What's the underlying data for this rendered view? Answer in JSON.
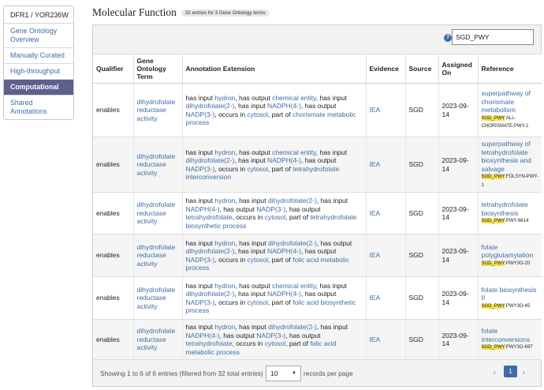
{
  "sidebar": {
    "header": "DFR1 / YOR236W",
    "items": [
      {
        "label": "Gene Ontology Overview",
        "active": false
      },
      {
        "label": "Manually Curated",
        "active": false
      },
      {
        "label": "High-throughput",
        "active": false
      },
      {
        "label": "Computational",
        "active": true
      },
      {
        "label": "Shared Annotations",
        "active": false
      }
    ]
  },
  "section": {
    "title": "Molecular Function",
    "badge": "32 entries for 3 Gene Ontology terms"
  },
  "search": {
    "help_icon": "question-circle-icon",
    "value": "SGD_PWY"
  },
  "table": {
    "headers": [
      "Qualifier",
      "Gene Ontology Term",
      "Annotation Extension",
      "Evidence",
      "Source",
      "Assigned On",
      "Reference"
    ],
    "rows": [
      {
        "qualifier": "enables",
        "term": "dihydrofolate reductase activity",
        "extension": [
          [
            "t",
            "has input "
          ],
          [
            "l",
            "hydron"
          ],
          [
            "t",
            ", has output "
          ],
          [
            "l",
            "chemical entity"
          ],
          [
            "t",
            ", has input "
          ],
          [
            "l",
            "dihydrofolate(2-)"
          ],
          [
            "t",
            ", has input "
          ],
          [
            "l",
            "NADPH(4-)"
          ],
          [
            "t",
            ", has output "
          ],
          [
            "l",
            "NADP(3-)"
          ],
          [
            "t",
            ", occurs in "
          ],
          [
            "l",
            "cytosol"
          ],
          [
            "t",
            ", part of "
          ],
          [
            "l",
            "chorismate metabolic process"
          ]
        ],
        "evidence": "IEA",
        "source": "SGD",
        "assigned": "2023-09-14",
        "ref_title": "superpathway of chorismate metabolism",
        "ref_prefix": "SGD_PWY",
        "ref_suffix": ":ALL-CHORISMATE-PWY-1"
      },
      {
        "qualifier": "enables",
        "term": "dihydrofolate reductase activity",
        "extension": [
          [
            "t",
            "has input "
          ],
          [
            "l",
            "hydron"
          ],
          [
            "t",
            ", has output "
          ],
          [
            "l",
            "chemical entity"
          ],
          [
            "t",
            ", has input "
          ],
          [
            "l",
            "dihydrofolate(2-)"
          ],
          [
            "t",
            ", has input "
          ],
          [
            "l",
            "NADPH(4-)"
          ],
          [
            "t",
            ", has output "
          ],
          [
            "l",
            "NADP(3-)"
          ],
          [
            "t",
            ", occurs in "
          ],
          [
            "l",
            "cytosol"
          ],
          [
            "t",
            ", part of "
          ],
          [
            "l",
            "tetrahydrofolate interconversion"
          ]
        ],
        "evidence": "IEA",
        "source": "SGD",
        "assigned": "2023-09-14",
        "ref_title": "superpathway of tetrahydrofolate biosynthesis and salvage",
        "ref_prefix": "SGD_PWY",
        "ref_suffix": ":FOLSYN-PWY-1"
      },
      {
        "qualifier": "enables",
        "term": "dihydrofolate reductase activity",
        "extension": [
          [
            "t",
            "has input "
          ],
          [
            "l",
            "hydron"
          ],
          [
            "t",
            ", has input "
          ],
          [
            "l",
            "dihydrofolate(2-)"
          ],
          [
            "t",
            ", has input "
          ],
          [
            "l",
            "NADPH(4-)"
          ],
          [
            "t",
            ", has output "
          ],
          [
            "l",
            "NADP(3-)"
          ],
          [
            "t",
            ", has output "
          ],
          [
            "l",
            "tetrahydrofolate"
          ],
          [
            "t",
            ", occurs in "
          ],
          [
            "l",
            "cytosol"
          ],
          [
            "t",
            ", part of "
          ],
          [
            "l",
            "tetrahydrofolate biosynthetic process"
          ]
        ],
        "evidence": "IEA",
        "source": "SGD",
        "assigned": "2023-09-14",
        "ref_title": "tetrahydrofolate biosynthesis",
        "ref_prefix": "SGD_PWY",
        "ref_suffix": ":PWY-6614"
      },
      {
        "qualifier": "enables",
        "term": "dihydrofolate reductase activity",
        "extension": [
          [
            "t",
            "has input "
          ],
          [
            "l",
            "hydron"
          ],
          [
            "t",
            ", has input "
          ],
          [
            "l",
            "dihydrofolate(2-)"
          ],
          [
            "t",
            ", has output "
          ],
          [
            "l",
            "dihydrofolate(2-)"
          ],
          [
            "t",
            ", has input "
          ],
          [
            "l",
            "NADPH(4-)"
          ],
          [
            "t",
            ", has output "
          ],
          [
            "l",
            "NADP(3-)"
          ],
          [
            "t",
            ", occurs in "
          ],
          [
            "l",
            "cytosol"
          ],
          [
            "t",
            ", part of "
          ],
          [
            "l",
            "folic acid metabolic process"
          ]
        ],
        "evidence": "IEA",
        "source": "SGD",
        "assigned": "2023-09-14",
        "ref_title": "folate polyglutamylation",
        "ref_prefix": "SGD_PWY",
        "ref_suffix": ":PWY3O-20"
      },
      {
        "qualifier": "enables",
        "term": "dihydrofolate reductase activity",
        "extension": [
          [
            "t",
            "has input "
          ],
          [
            "l",
            "hydron"
          ],
          [
            "t",
            ", has output "
          ],
          [
            "l",
            "chemical entity"
          ],
          [
            "t",
            ", has input "
          ],
          [
            "l",
            "dihydrofolate(2-)"
          ],
          [
            "t",
            ", has input "
          ],
          [
            "l",
            "NADPH(4-)"
          ],
          [
            "t",
            ", has output "
          ],
          [
            "l",
            "NADP(3-)"
          ],
          [
            "t",
            ", occurs in "
          ],
          [
            "l",
            "cytosol"
          ],
          [
            "t",
            ", part of "
          ],
          [
            "l",
            "folic acid biosynthetic process"
          ]
        ],
        "evidence": "IEA",
        "source": "SGD",
        "assigned": "2023-09-14",
        "ref_title": "folate biosynthesis II",
        "ref_prefix": "SGD_PWY",
        "ref_suffix": ":PWY3O-45"
      },
      {
        "qualifier": "enables",
        "term": "dihydrofolate reductase activity",
        "extension": [
          [
            "t",
            "has input "
          ],
          [
            "l",
            "hydron"
          ],
          [
            "t",
            ", has input "
          ],
          [
            "l",
            "dihydrofolate(2-)"
          ],
          [
            "t",
            ", has input "
          ],
          [
            "l",
            "NADPH(4-)"
          ],
          [
            "t",
            ", has output "
          ],
          [
            "l",
            "NADP(3-)"
          ],
          [
            "t",
            ", has output "
          ],
          [
            "l",
            "tetrahydrofolate"
          ],
          [
            "t",
            ", occurs in "
          ],
          [
            "l",
            "cytosol"
          ],
          [
            "t",
            ", part of "
          ],
          [
            "l",
            "folic acid metabolic process"
          ]
        ],
        "evidence": "IEA",
        "source": "SGD",
        "assigned": "2023-09-14",
        "ref_title": "folate interconversions",
        "ref_prefix": "SGD_PWY",
        "ref_suffix": ":PWY3O-697"
      }
    ]
  },
  "footer": {
    "info": "Showing 1 to 6 of 6 entries (filtered from 32 total entries)",
    "page_size": "10",
    "records_label": "records per page",
    "prev": "‹",
    "current_page": "1",
    "next": "›",
    "caret_icon": "caret-down-icon"
  }
}
